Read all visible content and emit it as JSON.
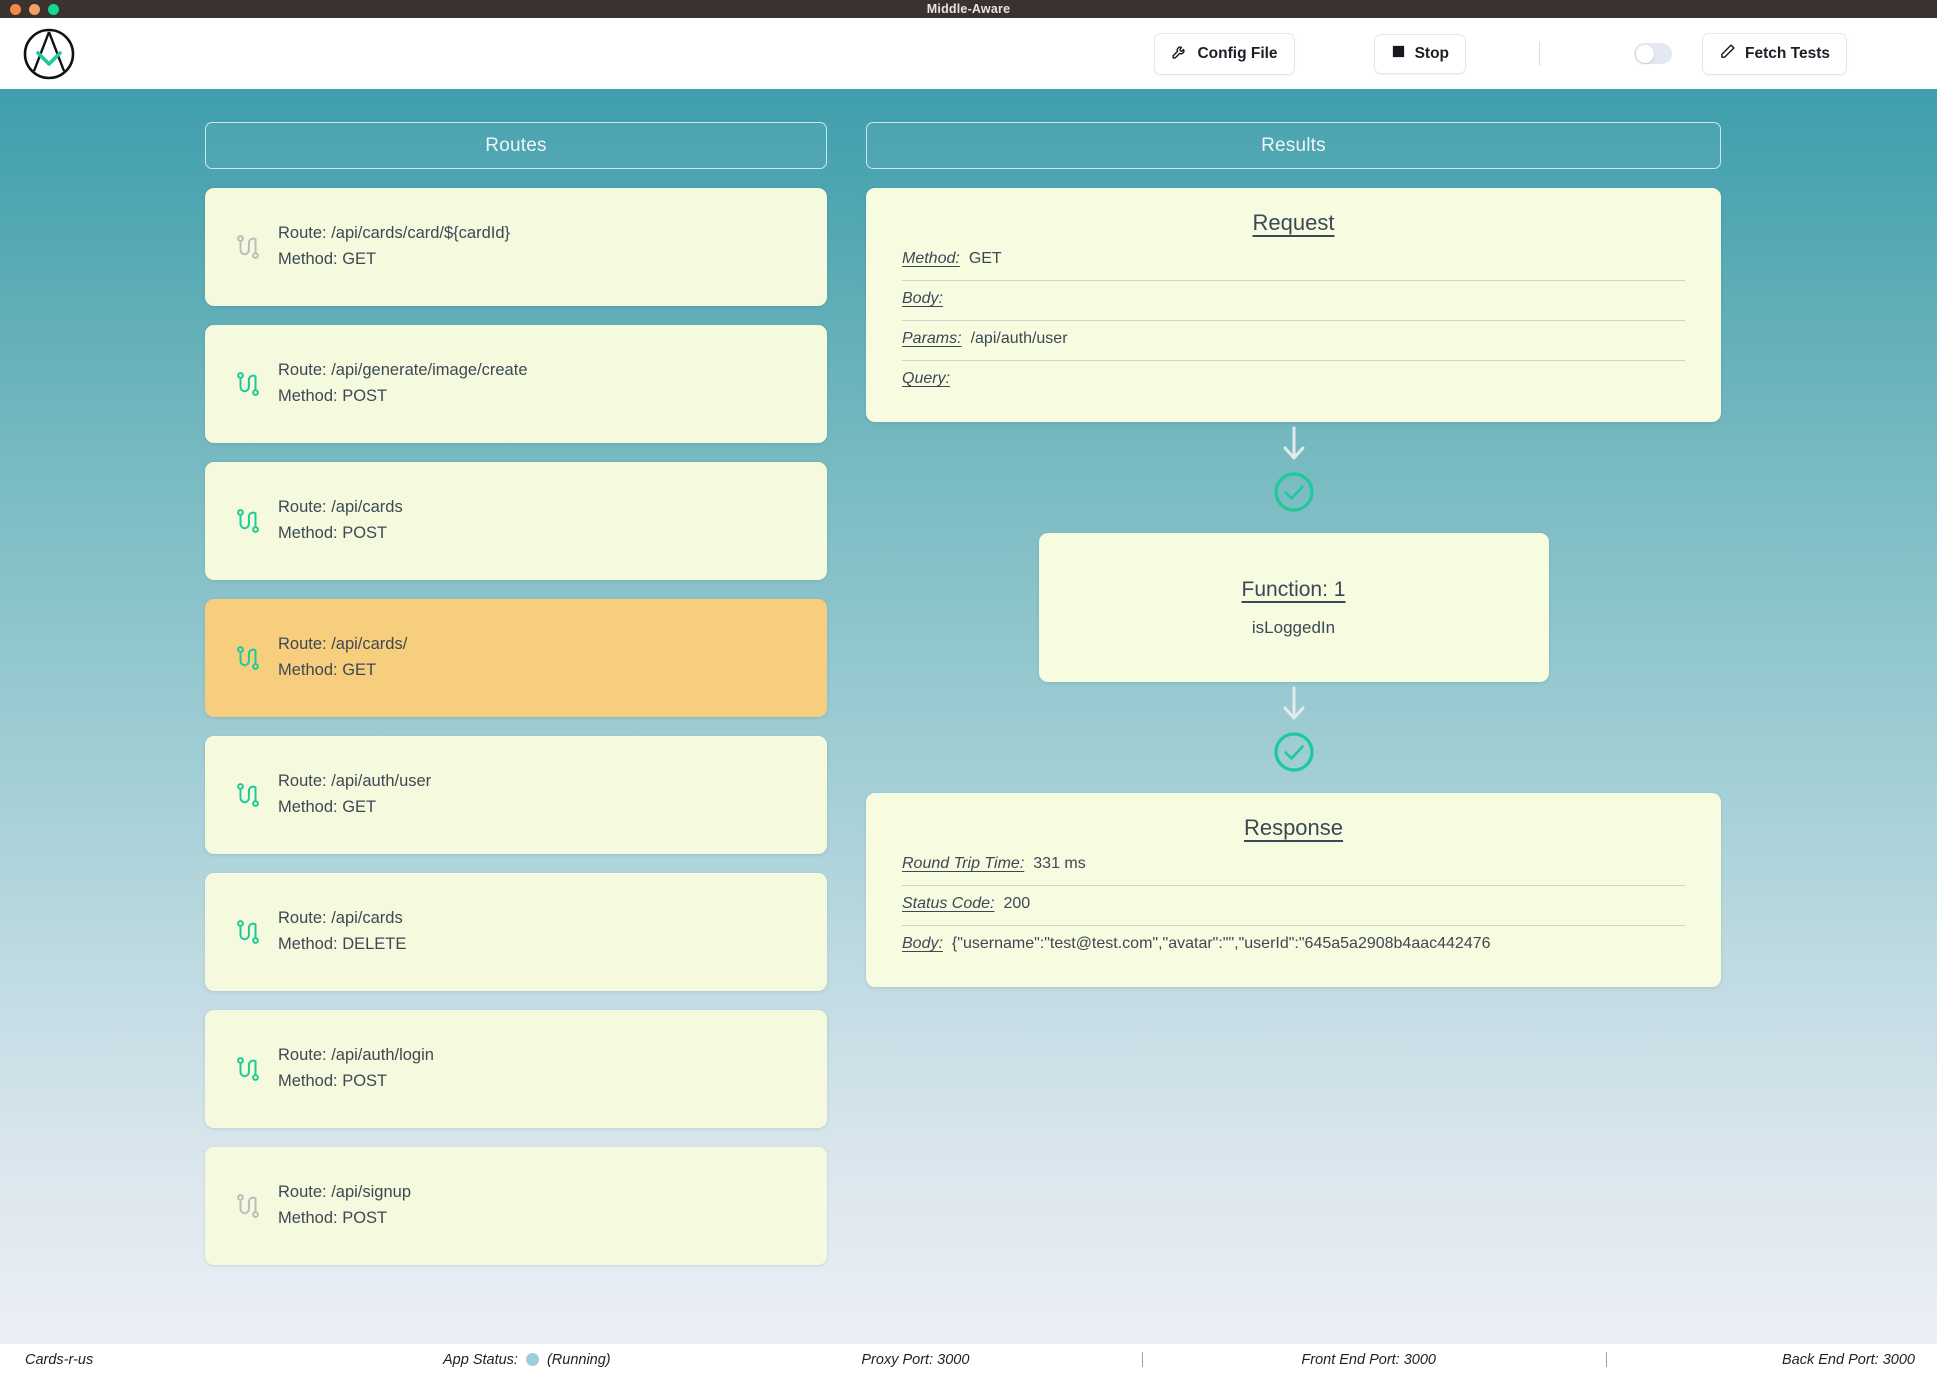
{
  "window": {
    "title": "Middle-Aware",
    "traffic_lights": [
      "close",
      "minimize",
      "maximize"
    ]
  },
  "toolbar": {
    "logo_name": "middle-aware-logo",
    "config_button": "Config File",
    "stop_button": "Stop",
    "fetch_tests_button": "Fetch Tests",
    "toggle_state": "off"
  },
  "routes_panel": {
    "header": "Routes",
    "items": [
      {
        "route": "Route: /api/cards/card/${cardId}",
        "method": "Method: GET",
        "icon_color": "#b9bdbd",
        "selected": false
      },
      {
        "route": "Route: /api/generate/image/create",
        "method": "Method: POST",
        "icon_color": "#1ec99a",
        "selected": false
      },
      {
        "route": "Route: /api/cards",
        "method": "Method: POST",
        "icon_color": "#1ec99a",
        "selected": false
      },
      {
        "route": "Route: /api/cards/",
        "method": "Method: GET",
        "icon_color": "#1ec99a",
        "selected": true
      },
      {
        "route": "Route: /api/auth/user",
        "method": "Method: GET",
        "icon_color": "#1ec99a",
        "selected": false
      },
      {
        "route": "Route: /api/cards",
        "method": "Method: DELETE",
        "icon_color": "#1ec99a",
        "selected": false
      },
      {
        "route": "Route: /api/auth/login",
        "method": "Method: POST",
        "icon_color": "#1ec99a",
        "selected": false
      },
      {
        "route": "Route: /api/signup",
        "method": "Method: POST",
        "icon_color": "#b9bdbd",
        "selected": false
      }
    ]
  },
  "results_panel": {
    "header": "Results",
    "request": {
      "title": "Request",
      "rows": [
        {
          "key": "Method:",
          "value": "GET"
        },
        {
          "key": "Body:",
          "value": ""
        },
        {
          "key": "Params:",
          "value": "/api/auth/user"
        },
        {
          "key": "Query:",
          "value": ""
        }
      ]
    },
    "function": {
      "title": "Function: 1",
      "name": "isLoggedIn"
    },
    "response": {
      "title": "Response",
      "rows": [
        {
          "key": "Round Trip Time:",
          "value": "331 ms"
        },
        {
          "key": "Status Code:",
          "value": "200"
        },
        {
          "key": "Body:",
          "value": "{\"username\":\"test@test.com\",\"avatar\":\"\",\"userId\":\"645a5a2908b4aac442476"
        }
      ]
    },
    "status_icons": [
      "check-pass",
      "check-pass"
    ]
  },
  "statusbar": {
    "app_name": "Cards-r-us",
    "app_status_label": "App Status:",
    "app_status_value": "(Running)",
    "app_status_color": "#9ecdda",
    "proxy_port": "Proxy Port: 3000",
    "front_end_port": "Front End Port: 3000",
    "back_end_port": "Back End Port: 3000"
  },
  "colors": {
    "accent_teal": "#1ec99a",
    "selected_route": "#f7ce7d",
    "card_bg": "#f7fbdf",
    "bg_top": "#3f9eae",
    "bg_bottom": "#eceff6"
  }
}
